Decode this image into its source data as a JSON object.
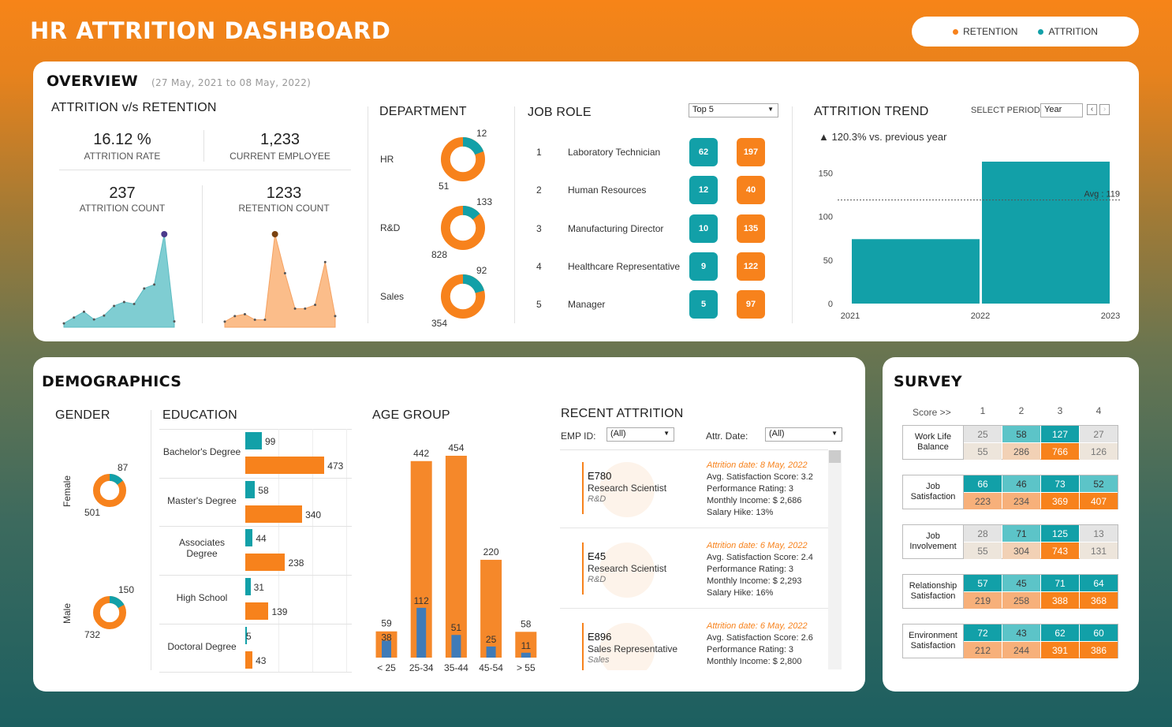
{
  "title": "HR ATTRITION DASHBOARD",
  "legend": {
    "retention": "RETENTION",
    "attrition": "ATTRITION"
  },
  "colors": {
    "retention": "#f7821c",
    "attrition": "#12a0a8"
  },
  "overview": {
    "heading": "OVERVIEW",
    "date_range": "(27 May, 2021 to 08 May, 2022)",
    "attr_vs_ret": {
      "title": "ATTRITION v/s RETENTION",
      "attrition_rate": "16.12 %",
      "attrition_rate_label": "ATTRITION RATE",
      "current_employee": "1,233",
      "current_employee_label": "CURRENT EMPLOYEE",
      "attrition_count": "237",
      "attrition_count_label": "ATTRITION COUNT",
      "retention_count": "1233",
      "retention_count_label": "RETENTION COUNT",
      "attrition_spark": [
        2,
        5,
        8,
        4,
        6,
        11,
        13,
        12,
        20,
        22,
        48,
        3
      ],
      "retention_spark": [
        3,
        6,
        7,
        4,
        4,
        50,
        29,
        10,
        10,
        12,
        35,
        6
      ]
    },
    "department": {
      "title": "DEPARTMENT",
      "items": [
        {
          "name": "HR",
          "attrition": "12",
          "retention": "51",
          "a": 12,
          "r": 51
        },
        {
          "name": "R&D",
          "attrition": "133",
          "retention": "828",
          "a": 133,
          "r": 828
        },
        {
          "name": "Sales",
          "attrition": "92",
          "retention": "354",
          "a": 92,
          "r": 354
        }
      ]
    },
    "job_role": {
      "title": "JOB ROLE",
      "filter": "Top 5",
      "items": [
        {
          "rank": "1",
          "name": "Laboratory Technician",
          "attrition": "62",
          "retention": "197"
        },
        {
          "rank": "2",
          "name": "Human Resources",
          "attrition": "12",
          "retention": "40"
        },
        {
          "rank": "3",
          "name": "Manufacturing Director",
          "attrition": "10",
          "retention": "135"
        },
        {
          "rank": "4",
          "name": "Healthcare Representative",
          "attrition": "9",
          "retention": "122"
        },
        {
          "rank": "5",
          "name": "Manager",
          "attrition": "5",
          "retention": "97"
        }
      ]
    },
    "trend": {
      "title": "ATTRITION TREND",
      "select_label": "SELECT PERIOD",
      "period": "Year",
      "prev": "‹",
      "next": "›",
      "change": "▲ 120.3% vs. previous year",
      "avg_label": "Avg : 119"
    }
  },
  "chart_data": {
    "type": "bar",
    "title": "ATTRITION TREND",
    "x_ticks": [
      "2021",
      "2022",
      "2023"
    ],
    "series": [
      {
        "values": [
          74,
          163
        ]
      }
    ],
    "bins": [
      [
        2021,
        2022
      ],
      [
        2022,
        2023
      ]
    ],
    "ylim": [
      0,
      163
    ],
    "y_ticks": [
      0,
      50,
      100,
      150
    ],
    "average": 119
  },
  "demographics": {
    "heading": "DEMOGRAPHICS",
    "gender": {
      "title": "GENDER",
      "items": [
        {
          "name": "Female",
          "attrition": "87",
          "retention": "501",
          "a": 87,
          "r": 501
        },
        {
          "name": "Male",
          "attrition": "150",
          "retention": "732",
          "a": 150,
          "r": 732
        }
      ]
    },
    "education": {
      "title": "EDUCATION",
      "items": [
        {
          "name": "Bachelor's Degree",
          "attrition": 99,
          "retention": 473
        },
        {
          "name": "Master's Degree",
          "attrition": 58,
          "retention": 340
        },
        {
          "name": "Associates Degree",
          "attrition": 44,
          "retention": 238
        },
        {
          "name": "High School",
          "attrition": 31,
          "retention": 139
        },
        {
          "name": "Doctoral Degree",
          "attrition": 5,
          "retention": 43
        }
      ]
    },
    "age_group": {
      "title": "AGE GROUP",
      "items": [
        {
          "name": "< 25",
          "retention": 59,
          "attrition": 38
        },
        {
          "name": "25-34",
          "retention": 442,
          "attrition": 112
        },
        {
          "name": "35-44",
          "retention": 454,
          "attrition": 51
        },
        {
          "name": "45-54",
          "retention": 220,
          "attrition": 25
        },
        {
          "name": "> 55",
          "retention": 58,
          "attrition": 11
        }
      ]
    },
    "recent": {
      "title": "RECENT ATTRITION",
      "emp_label": "EMP ID:",
      "emp_value": "(All)",
      "date_label": "Attr. Date:",
      "date_value": "(All)",
      "items": [
        {
          "id": "E780",
          "role": "Research Scientist",
          "dept": "R&D",
          "date": "Attrition date: 8 May, 2022",
          "sat": "Avg. Satisfaction Score: 3.2",
          "perf": "Performance Rating: 3",
          "income": "Monthly Income: $ 2,686",
          "hike": "Salary Hike: 13%"
        },
        {
          "id": "E45",
          "role": "Research Scientist",
          "dept": "R&D",
          "date": "Attrition date: 6 May, 2022",
          "sat": "Avg. Satisfaction Score: 2.4",
          "perf": "Performance Rating: 3",
          "income": "Monthly Income: $ 2,293",
          "hike": "Salary Hike: 16%"
        },
        {
          "id": "E896",
          "role": "Sales Representative",
          "dept": "Sales",
          "date": "Attrition date: 6 May, 2022",
          "sat": "Avg. Satisfaction Score: 2.6",
          "perf": "Performance Rating: 3",
          "income": "Monthly Income: $ 2,800",
          "hike": ""
        }
      ]
    }
  },
  "survey": {
    "heading": "SURVEY",
    "score_label": "Score >>",
    "scores": [
      "1",
      "2",
      "3",
      "4"
    ],
    "rows": [
      {
        "name": "Work Life Balance",
        "attrition": [
          25,
          58,
          127,
          27
        ],
        "retention": [
          55,
          286,
          766,
          126
        ]
      },
      {
        "name": "Job Satisfaction",
        "attrition": [
          66,
          46,
          73,
          52
        ],
        "retention": [
          223,
          234,
          369,
          407
        ]
      },
      {
        "name": "Job Involvement",
        "attrition": [
          28,
          71,
          125,
          13
        ],
        "retention": [
          55,
          304,
          743,
          131
        ]
      },
      {
        "name": "Relationship Satisfaction",
        "attrition": [
          57,
          45,
          71,
          64
        ],
        "retention": [
          219,
          258,
          388,
          368
        ]
      },
      {
        "name": "Environment Satisfaction",
        "attrition": [
          72,
          43,
          62,
          60
        ],
        "retention": [
          212,
          244,
          391,
          386
        ]
      }
    ]
  }
}
